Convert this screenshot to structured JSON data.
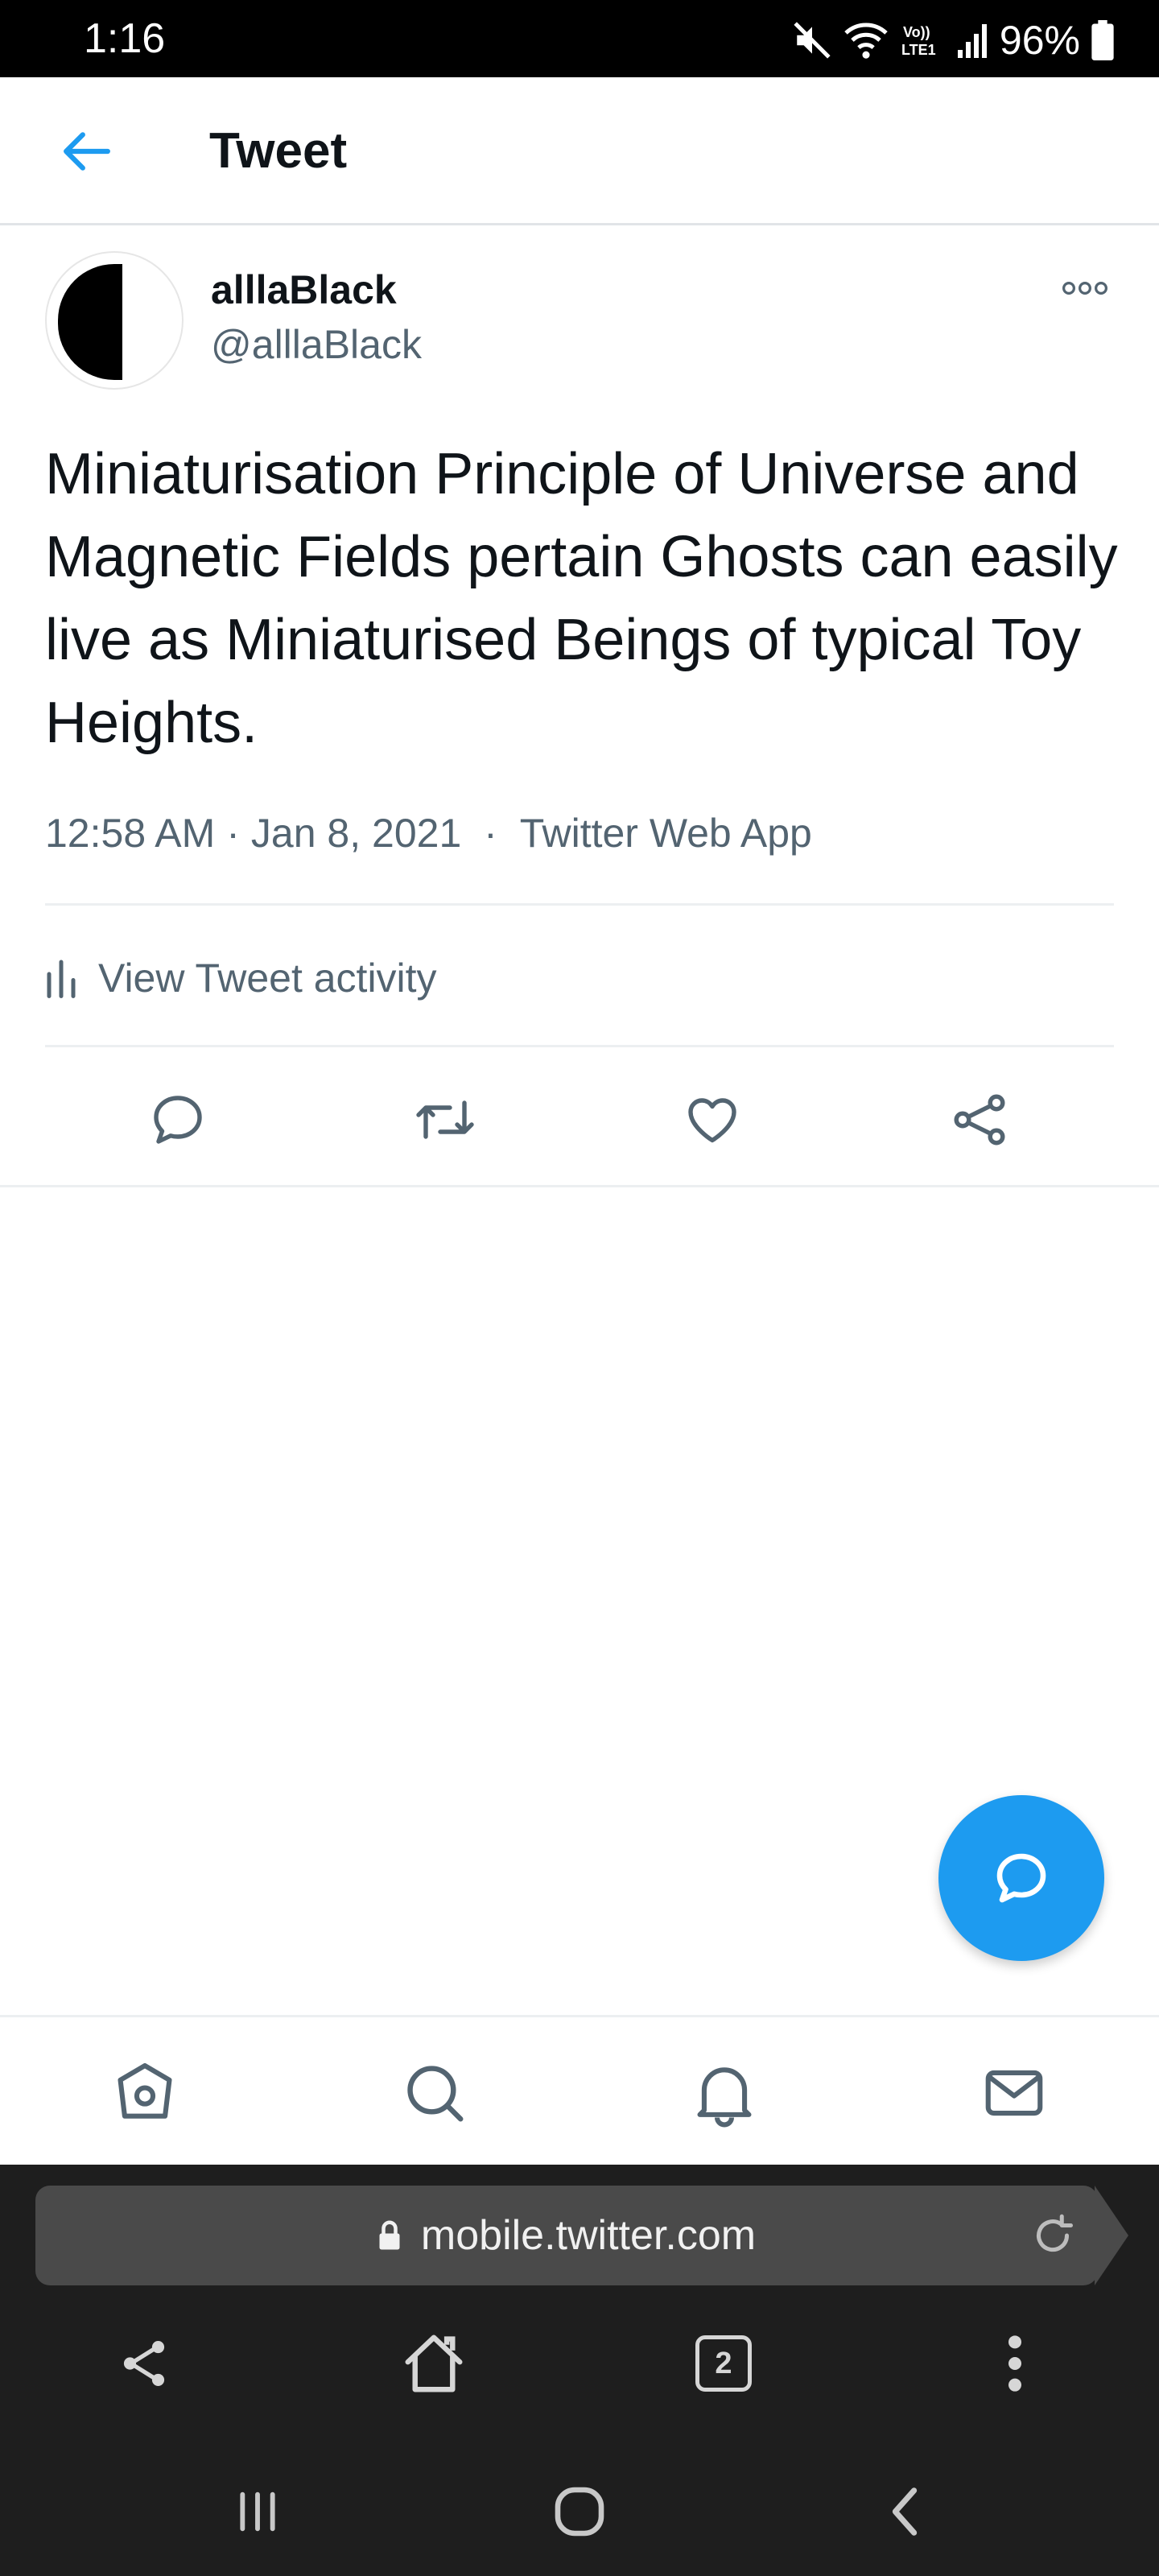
{
  "status_bar": {
    "time": "1:16",
    "battery": "96%",
    "network_label": "Vo)) LTE1"
  },
  "header": {
    "title": "Tweet"
  },
  "tweet": {
    "author_name": "alllaBlack",
    "author_handle": "@alllaBlack",
    "text": "Miniaturisation Principle of Universe and Magnetic Fields pertain Ghosts can easily live as Miniaturised Beings of typical Toy Heights.",
    "time": "12:58 AM",
    "date": "Jan 8, 2021",
    "source": "Twitter Web App",
    "activity_label": "View Tweet activity"
  },
  "actions": [
    "reply-icon",
    "retweet-icon",
    "like-icon",
    "share-icon"
  ],
  "bottom_nav": [
    "home-icon",
    "search-icon",
    "notifications-icon",
    "messages-icon"
  ],
  "browser": {
    "url": "mobile.twitter.com",
    "tab_count": "2"
  },
  "colors": {
    "accent": "#1d9bf0",
    "secondary_text": "#536471",
    "browser_bg": "#1e1e1e"
  }
}
